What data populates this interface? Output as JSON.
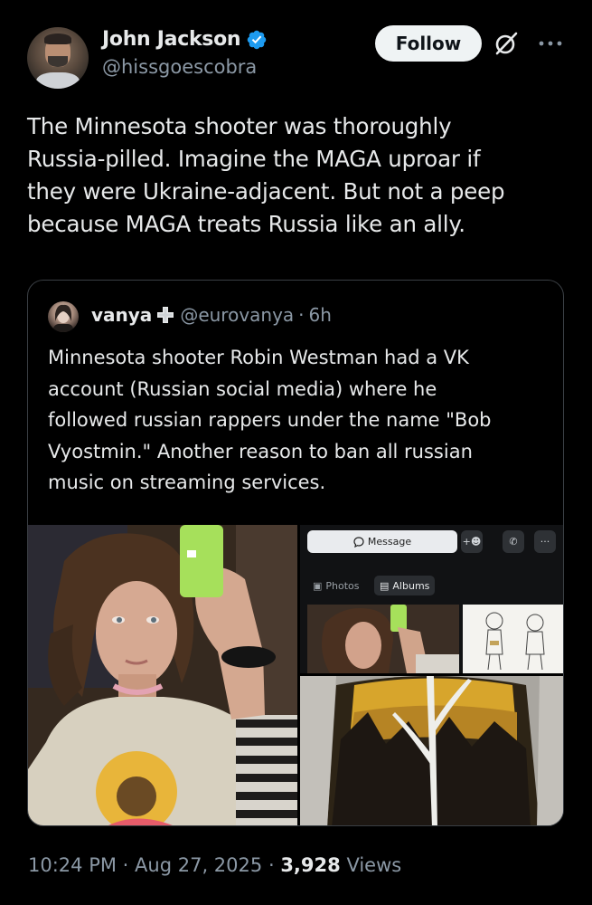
{
  "author": {
    "display_name": "John Jackson",
    "handle": "@hissgoescobra",
    "verified_color": "#1d9bf0"
  },
  "actions": {
    "follow_label": "Follow",
    "grok_icon": "grok-icon",
    "more_icon": "more-icon"
  },
  "tweet": {
    "text": "The Minnesota shooter was thoroughly\nRussia-pilled. Imagine the MAGA uproar if\nthey were Ukraine-adjacent. But not a peep\nbecause MAGA treats Russia like an ally."
  },
  "quote": {
    "display_name": "vanya",
    "badge_icon": "medical-cross-icon",
    "handle": "@eurovanya",
    "separator": "·",
    "time": "6h",
    "text": "Minnesota shooter Robin Westman had a VK\naccount (Russian social media) where he\nfollowed russian rappers under the name \"Bob\nVyostmin.\" Another reason to ban all russian\nmusic on streaming services.",
    "media": {
      "vk_message_label": "Message",
      "vk_tab_photos": "Photos",
      "vk_tab_albums": "Albums",
      "vk_add_friend_icon": "add-friend-icon",
      "vk_call_icon": "phone-icon",
      "vk_more_icon": "more-icon"
    }
  },
  "meta": {
    "time": "10:24 PM",
    "separator": "·",
    "date": "Aug 27, 2025",
    "views_count": "3,928",
    "views_label": "Views"
  },
  "colors": {
    "background": "#000000",
    "text_primary": "#e7e9ea",
    "text_secondary": "#8b98a5",
    "border": "#3a3f44",
    "follow_bg": "#eff3f4"
  }
}
